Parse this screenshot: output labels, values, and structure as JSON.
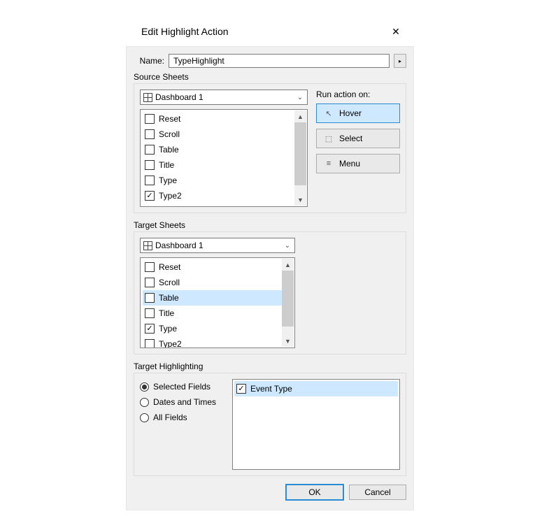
{
  "dialog": {
    "title": "Edit Highlight Action",
    "close_glyph": "✕"
  },
  "name": {
    "label": "Name:",
    "value": "TypeHighlight",
    "menu_glyph": "▸"
  },
  "source": {
    "label": "Source Sheets",
    "combo": "Dashboard 1",
    "items": [
      {
        "label": "Reset",
        "checked": false
      },
      {
        "label": "Scroll",
        "checked": false
      },
      {
        "label": "Table",
        "checked": false
      },
      {
        "label": "Title",
        "checked": false
      },
      {
        "label": "Type",
        "checked": false
      },
      {
        "label": "Type2",
        "checked": true
      }
    ]
  },
  "run": {
    "label": "Run action on:",
    "hover": "Hover",
    "select": "Select",
    "menu": "Menu",
    "active": "hover"
  },
  "target": {
    "label": "Target Sheets",
    "combo": "Dashboard 1",
    "items": [
      {
        "label": "Reset",
        "checked": false
      },
      {
        "label": "Scroll",
        "checked": false
      },
      {
        "label": "Table",
        "checked": false,
        "selected": true
      },
      {
        "label": "Title",
        "checked": false
      },
      {
        "label": "Type",
        "checked": true
      },
      {
        "label": "Type2",
        "checked": false
      }
    ]
  },
  "highlight": {
    "label": "Target Highlighting",
    "radios": {
      "selected_fields": "Selected Fields",
      "dates_times": "Dates and Times",
      "all_fields": "All Fields",
      "value": "selected_fields"
    },
    "fields": [
      {
        "label": "Event Type",
        "checked": true,
        "selected": true
      }
    ]
  },
  "footer": {
    "ok": "OK",
    "cancel": "Cancel"
  },
  "glyphs": {
    "check": "✓",
    "dropdown": "⌄",
    "up": "▲",
    "down": "▼",
    "cursor": "↖",
    "select": "⬚",
    "menu": "≡"
  }
}
